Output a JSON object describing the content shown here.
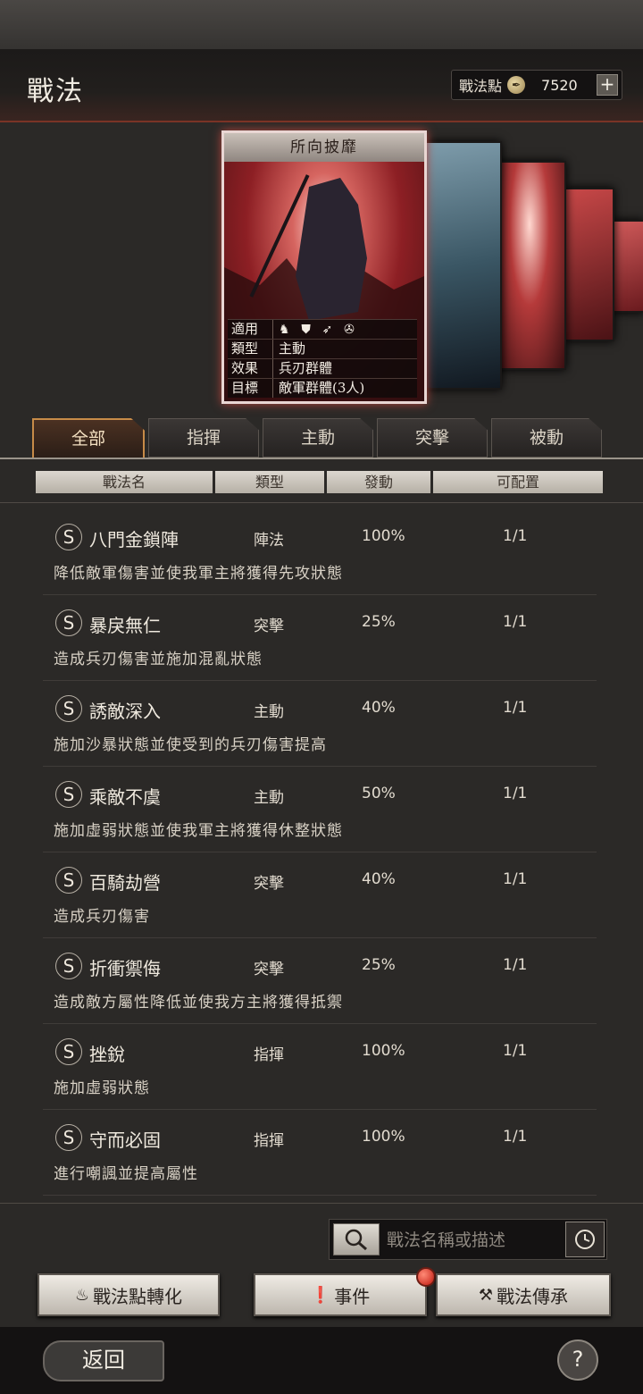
{
  "header": {
    "title": "戰法",
    "points_label": "戰法點",
    "points_value": "7520",
    "points_icon": "tactic-point-coin-icon",
    "plus_label": "+"
  },
  "featured_card": {
    "title": "所向披靡",
    "info": [
      {
        "key": "適用",
        "value": ""
      },
      {
        "key": "類型",
        "value": "主動"
      },
      {
        "key": "效果",
        "value": "兵刃群體"
      },
      {
        "key": "目標",
        "value": "敵軍群體(3人)"
      }
    ],
    "applicable_icons": [
      "cavalry-icon",
      "shield-icon",
      "archer-icon",
      "siege-wheel-icon"
    ]
  },
  "tabs": [
    {
      "label": "全部",
      "active": true
    },
    {
      "label": "指揮",
      "active": false
    },
    {
      "label": "主動",
      "active": false
    },
    {
      "label": "突擊",
      "active": false
    },
    {
      "label": "被動",
      "active": false
    }
  ],
  "columns": [
    "戰法名",
    "類型",
    "發動",
    "可配置"
  ],
  "tactics": [
    {
      "grade": "S",
      "name": "八門金鎖陣",
      "type": "陣法",
      "rate": "100%",
      "slots": "1/1",
      "desc": "降低敵軍傷害並使我軍主將獲得先攻狀態"
    },
    {
      "grade": "S",
      "name": "暴戾無仁",
      "type": "突擊",
      "rate": "25%",
      "slots": "1/1",
      "desc": "造成兵刃傷害並施加混亂狀態"
    },
    {
      "grade": "S",
      "name": "誘敵深入",
      "type": "主動",
      "rate": "40%",
      "slots": "1/1",
      "desc": "施加沙暴狀態並使受到的兵刃傷害提高"
    },
    {
      "grade": "S",
      "name": "乘敵不虞",
      "type": "主動",
      "rate": "50%",
      "slots": "1/1",
      "desc": "施加虛弱狀態並使我軍主將獲得休整狀態"
    },
    {
      "grade": "S",
      "name": "百騎劫營",
      "type": "突擊",
      "rate": "40%",
      "slots": "1/1",
      "desc": "造成兵刃傷害"
    },
    {
      "grade": "S",
      "name": "折衝禦侮",
      "type": "突擊",
      "rate": "25%",
      "slots": "1/1",
      "desc": "造成敵方屬性降低並使我方主將獲得抵禦"
    },
    {
      "grade": "S",
      "name": "挫銳",
      "type": "指揮",
      "rate": "100%",
      "slots": "1/1",
      "desc": "施加虛弱狀態"
    },
    {
      "grade": "S",
      "name": "守而必固",
      "type": "指揮",
      "rate": "100%",
      "slots": "1/1",
      "desc": "進行嘲諷並提高屬性"
    }
  ],
  "search": {
    "placeholder": "戰法名稱或描述"
  },
  "buttons": {
    "convert": "戰法點轉化",
    "events": "事件",
    "inherit": "戰法傳承"
  },
  "footer": {
    "back_label": "返回",
    "help_label": "?"
  },
  "colors": {
    "accent": "#c78b48",
    "card_red": "#8d1f24",
    "notification": "#c0180e"
  }
}
